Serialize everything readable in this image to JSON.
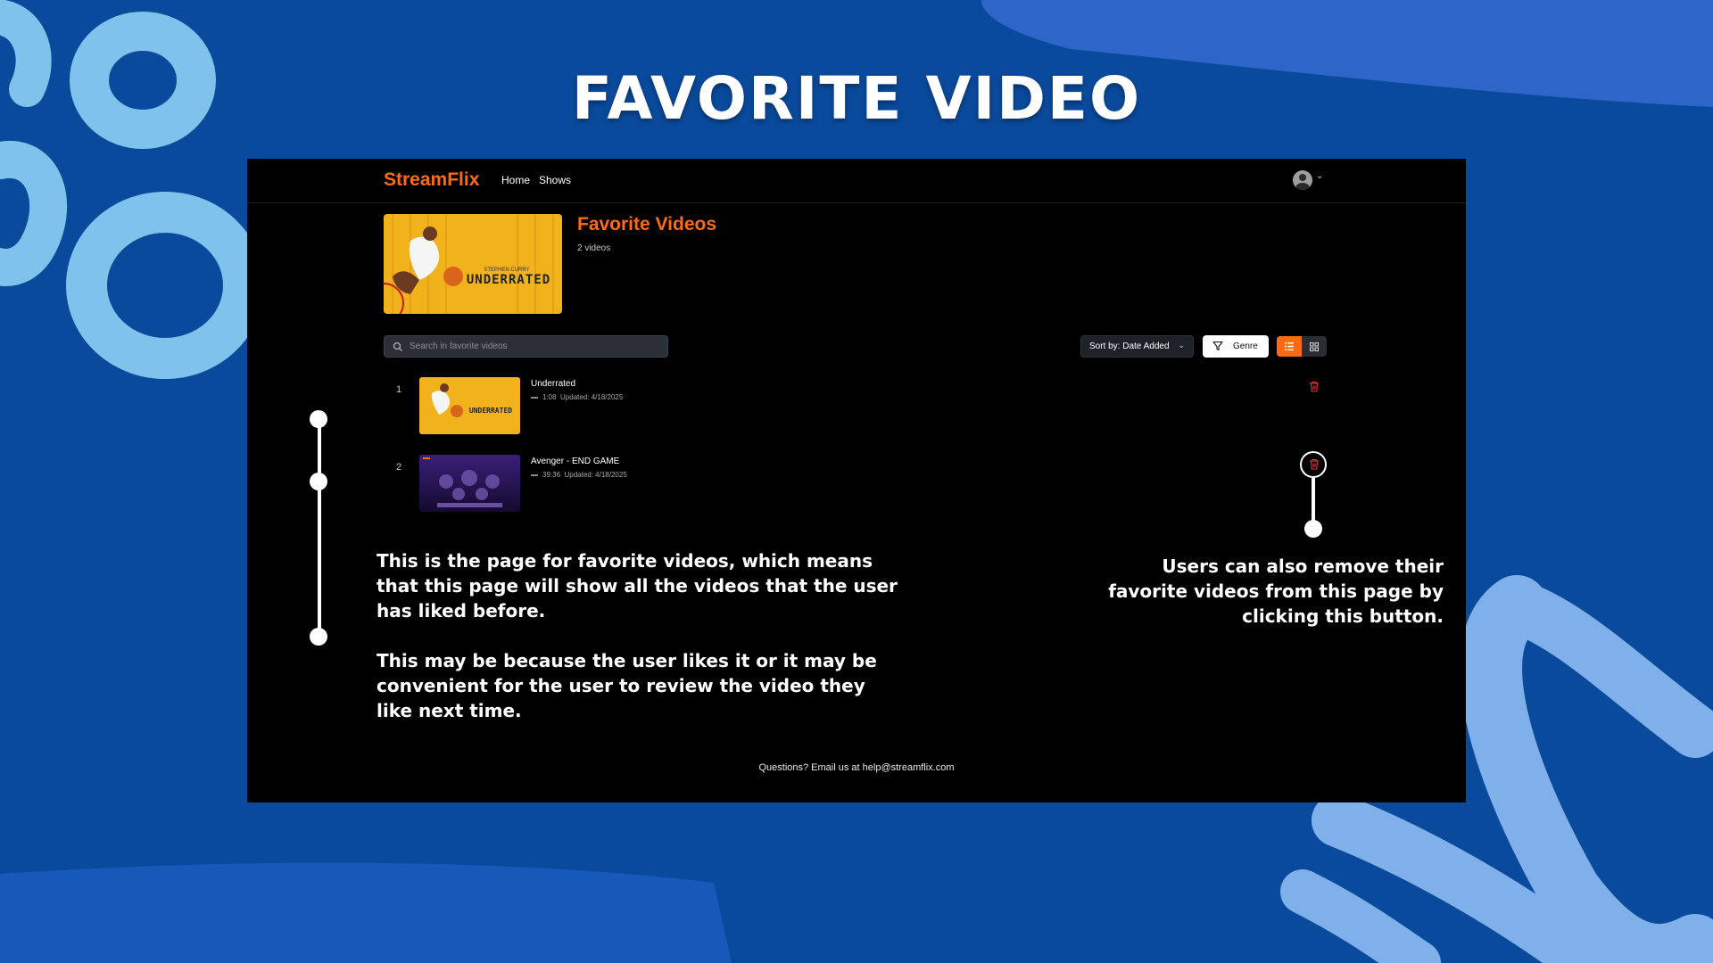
{
  "slide": {
    "title": "FAVORITE VIDEO"
  },
  "header": {
    "logo": "StreamFlix",
    "nav": [
      "Home",
      "Shows"
    ],
    "avatar_icon": "user-avatar-icon",
    "caret_icon": "chevron-down-icon"
  },
  "favorites": {
    "title": "Favorite Videos",
    "count_text": "2 videos",
    "cover_text": "UNDERRATED"
  },
  "toolbar": {
    "search_placeholder": "Search in favorite videos",
    "sort_label": "Sort by: Date Added",
    "genre_label": "Genre",
    "view_modes": [
      "list",
      "grid"
    ],
    "active_view": "list"
  },
  "videos": [
    {
      "index": "1",
      "title": "Underrated",
      "duration": "1:08",
      "updated": "Updated: 4/18/2025",
      "thumb_text": "UNDERRATED"
    },
    {
      "index": "2",
      "title": "Avenger - END GAME",
      "duration": "39:36",
      "updated": "Updated: 4/18/2025",
      "thumb_text": ""
    }
  ],
  "footer": {
    "text": "Questions? Email us at help@streamflix.com"
  },
  "annotations": {
    "left_p1": "This is the page for favorite videos, which means that this page will show all the videos that the user has liked before.",
    "left_p2": "This may be because the user likes it or it may be convenient for the user to review the video they like next time.",
    "right": "Users can also remove their favorite videos from this page by clicking this button."
  },
  "colors": {
    "background": "#0a4a9c",
    "brush": "#7fc3ec",
    "accent": "#ff6a13",
    "panel": "#000000",
    "delete": "#e53935"
  }
}
